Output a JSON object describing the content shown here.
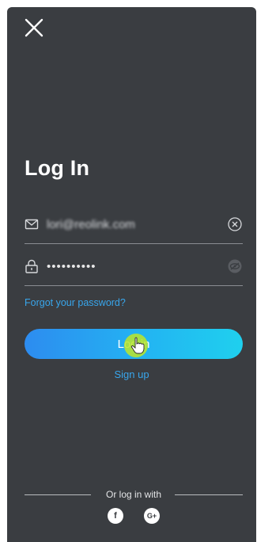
{
  "header": {
    "close_icon": "close-icon"
  },
  "title": "Log In",
  "email": {
    "icon": "mail-icon",
    "value": "lori@reolink.com",
    "clear_icon": "clear-circle-icon"
  },
  "password": {
    "icon": "lock-icon",
    "value": "••••••••••",
    "toggle_icon": "eye-hidden-icon"
  },
  "forgot_label": "Forgot your password?",
  "login_label": "Log in",
  "signup_label": "Sign up",
  "social": {
    "label": "Or log in with",
    "facebook_glyph": "f",
    "google_glyph": "G+"
  },
  "colors": {
    "background": "#3a3d41",
    "accent": "#38a6ec",
    "button_gradient_start": "#2d8cf0",
    "button_gradient_end": "#1fd0ee"
  }
}
